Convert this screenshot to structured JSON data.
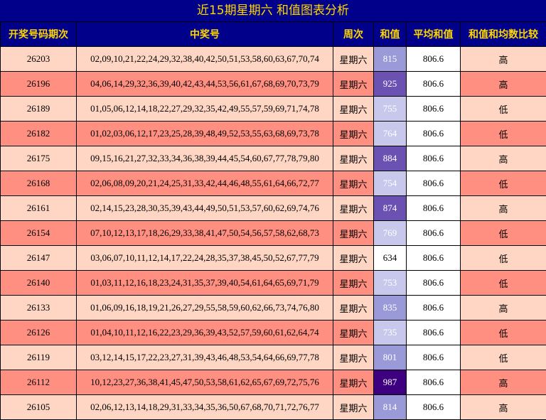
{
  "title": "近15期星期六 和值图表分析",
  "headers": [
    "开奖号码期次",
    "中奖号",
    "周次",
    "和值",
    "平均和值",
    "和值和均数比较"
  ],
  "row_colors": [
    "#ffd6c4",
    "#ff8f80"
  ],
  "sum_colors": {
    "low": "#c8c8ec",
    "mid": "#9a9ad8",
    "high": "#6b52b2",
    "top": "#3d007e"
  },
  "rows": [
    {
      "period": "26203",
      "numbers": "02,09,10,21,22,24,29,32,38,40,42,50,51,53,58,60,63,67,70,74",
      "weekday": "星期六",
      "sum": "815",
      "sum_level": "mid",
      "avg": "806.6",
      "compare": "高"
    },
    {
      "period": "26196",
      "numbers": "04,06,14,29,32,36,39,40,42,43,44,53,56,61,67,68,69,70,73,79",
      "weekday": "星期六",
      "sum": "925",
      "sum_level": "high",
      "avg": "806.6",
      "compare": "高"
    },
    {
      "period": "26189",
      "numbers": "01,05,06,12,14,18,22,27,29,32,35,42,49,55,57,59,69,71,74,78",
      "weekday": "星期六",
      "sum": "755",
      "sum_level": "low",
      "avg": "806.6",
      "compare": "低"
    },
    {
      "period": "26182",
      "numbers": "01,02,03,06,12,17,23,25,28,39,48,49,52,53,55,63,68,69,73,78",
      "weekday": "星期六",
      "sum": "764",
      "sum_level": "low",
      "avg": "806.6",
      "compare": "低"
    },
    {
      "period": "26175",
      "numbers": "09,15,16,21,27,32,33,34,36,38,39,44,45,54,60,67,77,78,79,80",
      "weekday": "星期六",
      "sum": "884",
      "sum_level": "high",
      "avg": "806.6",
      "compare": "高"
    },
    {
      "period": "26168",
      "numbers": "02,06,08,09,20,21,24,25,31,33,42,44,46,48,55,61,64,66,72,77",
      "weekday": "星期六",
      "sum": "754",
      "sum_level": "low",
      "avg": "806.6",
      "compare": "低"
    },
    {
      "period": "26161",
      "numbers": "02,14,15,23,28,30,35,39,43,44,49,50,51,53,57,60,62,69,74,76",
      "weekday": "星期六",
      "sum": "874",
      "sum_level": "high",
      "avg": "806.6",
      "compare": "高"
    },
    {
      "period": "26154",
      "numbers": "07,10,12,13,17,18,26,29,33,38,41,47,50,54,56,57,58,62,68,73",
      "weekday": "星期六",
      "sum": "769",
      "sum_level": "low",
      "avg": "806.6",
      "compare": "低"
    },
    {
      "period": "26147",
      "numbers": "03,06,07,10,11,12,14,17,22,24,28,35,37,38,45,50,52,67,77,79",
      "weekday": "星期六",
      "sum": "634",
      "sum_level": "none",
      "avg": "806.6",
      "compare": "低"
    },
    {
      "period": "26140",
      "numbers": "01,03,11,12,16,18,23,24,31,35,37,39,40,54,61,64,65,69,71,79",
      "weekday": "星期六",
      "sum": "753",
      "sum_level": "low",
      "avg": "806.6",
      "compare": "低"
    },
    {
      "period": "26133",
      "numbers": "01,06,09,16,18,19,21,26,27,29,55,58,59,60,62,66,73,74,76,80",
      "weekday": "星期六",
      "sum": "835",
      "sum_level": "mid",
      "avg": "806.6",
      "compare": "高"
    },
    {
      "period": "26126",
      "numbers": "01,04,10,11,12,16,22,23,29,36,39,43,52,57,59,60,61,62,64,74",
      "weekday": "星期六",
      "sum": "735",
      "sum_level": "low",
      "avg": "806.6",
      "compare": "低"
    },
    {
      "period": "26119",
      "numbers": "03,12,14,15,17,22,23,27,31,39,43,46,48,53,54,64,66,69,77,78",
      "weekday": "星期六",
      "sum": "801",
      "sum_level": "mid",
      "avg": "806.6",
      "compare": "低"
    },
    {
      "period": "26112",
      "numbers": "10,12,23,27,36,38,41,45,47,50,53,58,61,62,65,67,69,72,75,76",
      "weekday": "星期六",
      "sum": "987",
      "sum_level": "top",
      "avg": "806.6",
      "compare": "高"
    },
    {
      "period": "26105",
      "numbers": "02,06,12,13,14,18,29,31,33,34,35,36,50,67,68,70,71,72,76,77",
      "weekday": "星期六",
      "sum": "814",
      "sum_level": "mid",
      "avg": "806.6",
      "compare": "高"
    }
  ]
}
